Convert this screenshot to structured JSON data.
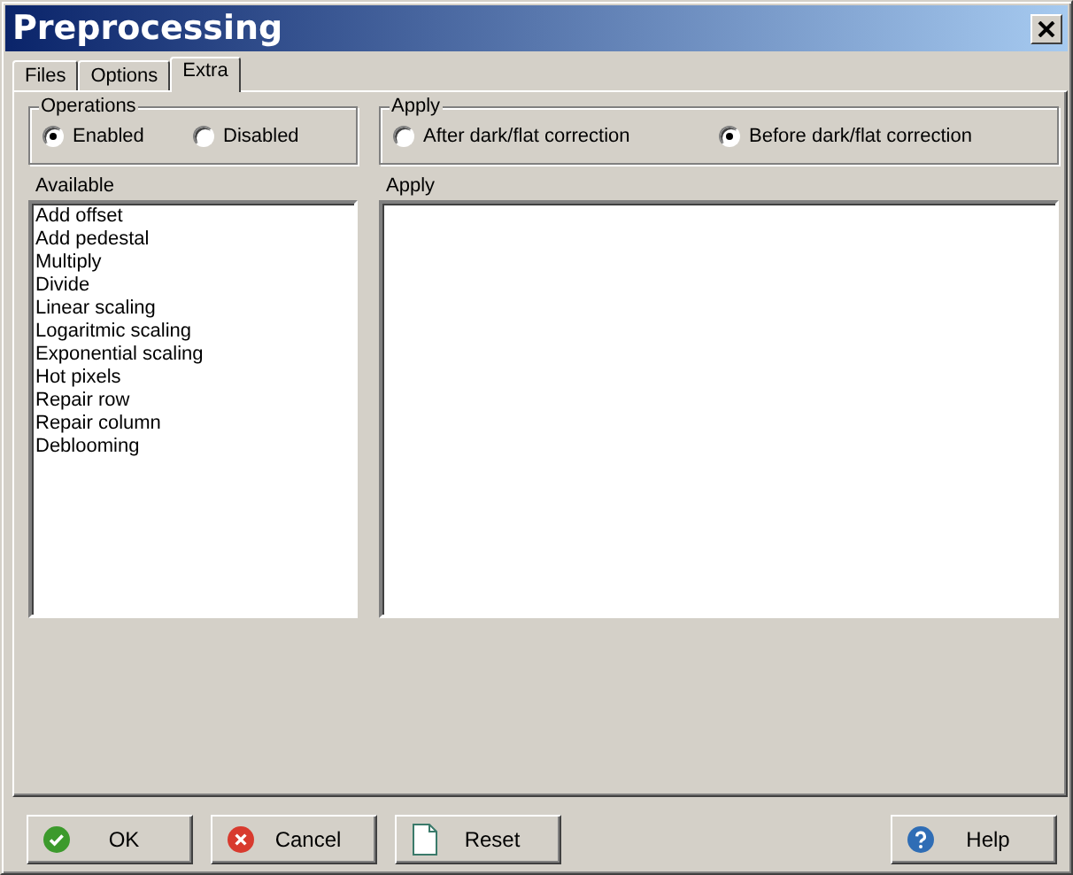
{
  "window": {
    "title": "Preprocessing"
  },
  "tabs": [
    {
      "label": "Files",
      "selected": false
    },
    {
      "label": "Options",
      "selected": false
    },
    {
      "label": "Extra",
      "selected": true
    }
  ],
  "groups": [
    {
      "title": "Operations",
      "options": [
        {
          "label": "Enabled",
          "selected": true
        },
        {
          "label": "Disabled",
          "selected": false
        }
      ]
    },
    {
      "title": "Apply",
      "options": [
        {
          "label": "After dark/flat correction",
          "selected": false
        },
        {
          "label": "Before dark/flat correction",
          "selected": true
        }
      ]
    }
  ],
  "lists": [
    {
      "label": "Available",
      "items": [
        "Add offset",
        "Add pedestal",
        "Multiply",
        "Divide",
        "Linear scaling",
        "Logaritmic scaling",
        "Exponential scaling",
        "Hot pixels",
        "Repair row",
        "Repair column",
        "Deblooming"
      ]
    },
    {
      "label": "Apply"
    }
  ],
  "buttons": [
    {
      "label": "OK",
      "kind": "ok"
    },
    {
      "label": "Cancel",
      "kind": "cancel"
    },
    {
      "label": "Reset",
      "kind": "reset"
    },
    {
      "label": "Help",
      "kind": "help"
    }
  ]
}
